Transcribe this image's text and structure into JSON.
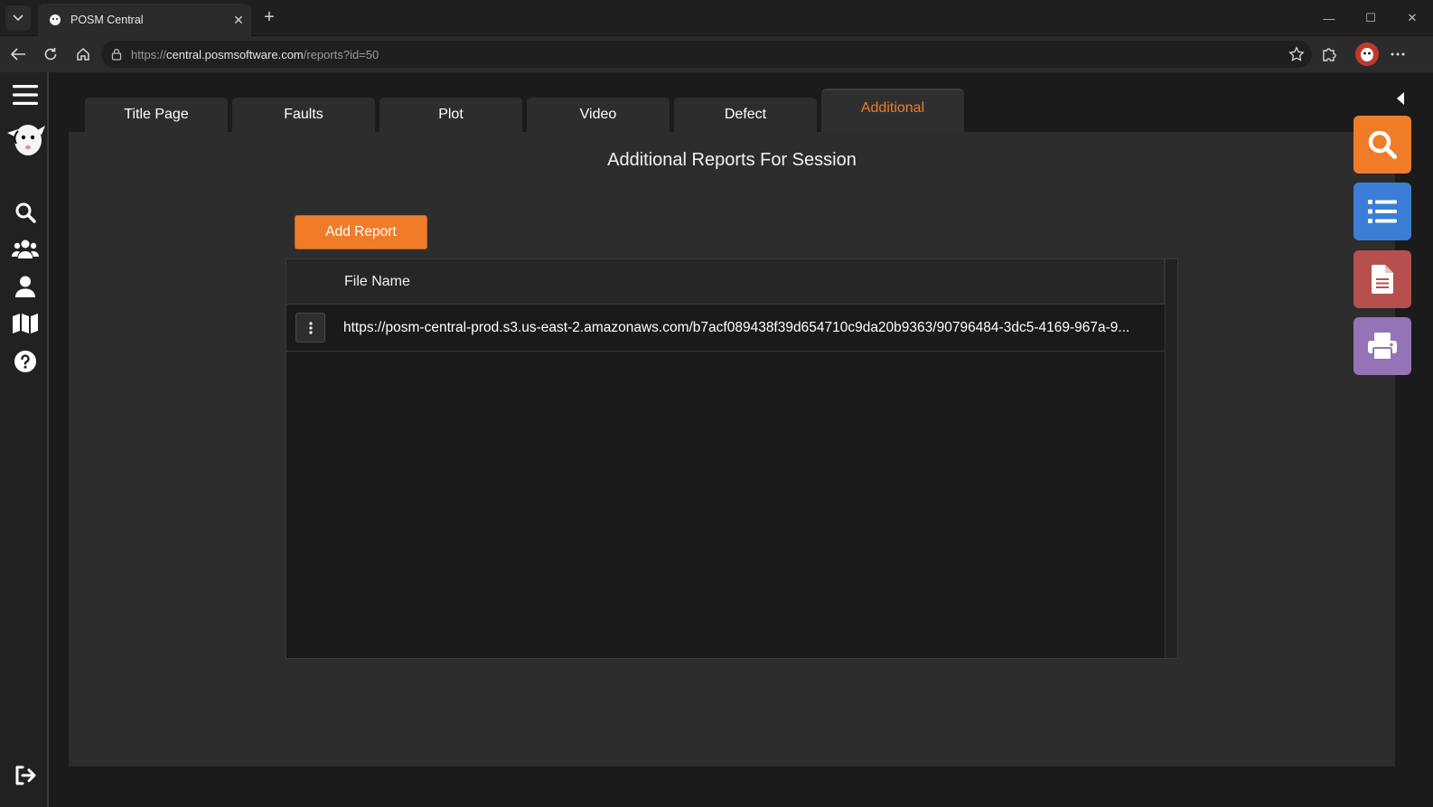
{
  "browser": {
    "tab_title": "POSM Central",
    "url_scheme": "https://",
    "url_host": "central.posmsoftware.com",
    "url_path": "/reports?id=50",
    "close_glyph": "✕",
    "new_tab_glyph": "+",
    "minimize_glyph": "—",
    "maximize_glyph": "☐",
    "window_close_glyph": "✕"
  },
  "tabs": [
    {
      "label": "Title Page",
      "active": false
    },
    {
      "label": "Faults",
      "active": false
    },
    {
      "label": "Plot",
      "active": false
    },
    {
      "label": "Video",
      "active": false
    },
    {
      "label": "Defect",
      "active": false
    },
    {
      "label": "Additional",
      "active": true
    }
  ],
  "panel": {
    "title": "Additional Reports For Session",
    "add_button": "Add Report"
  },
  "grid": {
    "columns": [
      "File Name"
    ],
    "rows": [
      {
        "file_name": "https://posm-central-prod.s3.us-east-2.amazonaws.com/b7acf089438f39d654710c9da20b9363/90796484-3dc5-4169-967a-9..."
      }
    ]
  },
  "colors": {
    "accent": "#f07c2a",
    "list_action": "#3a7fd5",
    "doc_action": "#b5504f",
    "print_action": "#9473b6"
  },
  "side_nav_icons": [
    "menu-icon",
    "posm-logo",
    "search-icon",
    "users-icon",
    "user-icon",
    "map-icon",
    "help-icon",
    "logout-icon"
  ],
  "action_icons": [
    "search-icon",
    "list-icon",
    "document-icon",
    "printer-icon"
  ]
}
